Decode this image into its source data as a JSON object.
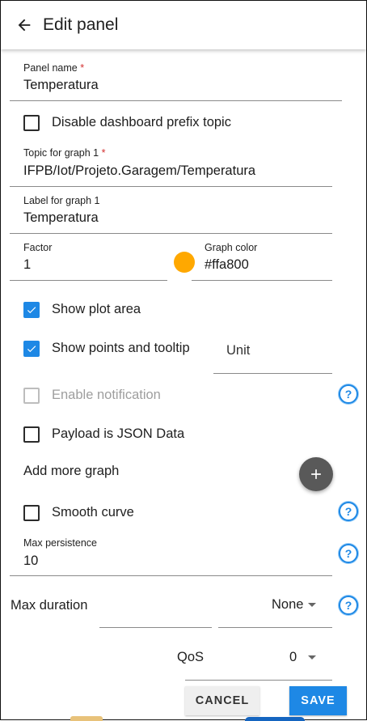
{
  "header": {
    "title": "Edit panel",
    "back_icon": "arrow-left-icon"
  },
  "form": {
    "panel_name": {
      "label": "Panel name",
      "required_mark": "*",
      "value": "Temperatura"
    },
    "disable_prefix": {
      "label": "Disable dashboard prefix topic",
      "checked": false
    },
    "topic_graph1": {
      "label": "Topic for graph 1",
      "required_mark": "*",
      "value": "IFPB/Iot/Projeto.Garagem/Temperatura"
    },
    "label_graph1": {
      "label": "Label for graph 1",
      "value": "Temperatura"
    },
    "factor": {
      "label": "Factor",
      "value": "1"
    },
    "graph_color": {
      "label": "Graph color",
      "value": "#ffa800",
      "swatch": "#ffa800"
    },
    "show_plot_area": {
      "label": "Show plot area",
      "checked": true
    },
    "show_points": {
      "label": "Show points and tooltip",
      "checked": true
    },
    "unit": {
      "placeholder": "Unit"
    },
    "enable_notification": {
      "label": "Enable notification",
      "checked": false,
      "disabled": true
    },
    "payload_json": {
      "label": "Payload is JSON Data",
      "checked": false
    },
    "add_more_graph": {
      "label": "Add more graph",
      "icon": "plus-icon"
    },
    "smooth_curve": {
      "label": "Smooth curve",
      "checked": false
    },
    "max_persistence": {
      "label": "Max persistence",
      "value": "10"
    },
    "max_duration": {
      "label": "Max duration",
      "value": "None"
    },
    "qos": {
      "label": "QoS",
      "value": "0"
    },
    "help_icon_glyph": "?"
  },
  "actions": {
    "cancel": "CANCEL",
    "save": "SAVE"
  },
  "colors": {
    "accent": "#1e88e5",
    "fab": "#595959",
    "required": "#d32f2f"
  }
}
